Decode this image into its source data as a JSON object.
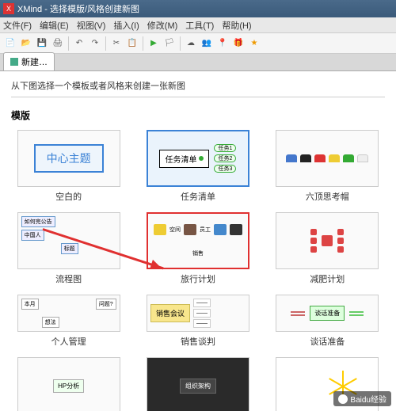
{
  "window": {
    "title": "XMind - 选择模版/风格创建新图",
    "app_icon_label": "X"
  },
  "menu": {
    "file": "文件(F)",
    "edit": "编辑(E)",
    "view": "视图(V)",
    "insert": "插入(I)",
    "modify": "修改(M)",
    "tools": "工具(T)",
    "help": "帮助(H)"
  },
  "tab": {
    "label": "新建…"
  },
  "intro": "从下图选择一个模板或者风格来创建一张新图",
  "section": {
    "templates": "模版"
  },
  "templates": [
    {
      "label": "空白的",
      "title_inside": "中心主题"
    },
    {
      "label": "任务清单",
      "title_inside": "任务清单",
      "branch": "任务"
    },
    {
      "label": "六顶思考帽"
    },
    {
      "label": "流程图",
      "box1": "如何完公告",
      "box2": "中国人",
      "box3": "标题"
    },
    {
      "label": "旅行计划",
      "items": [
        "空间",
        "员工",
        "销售"
      ]
    },
    {
      "label": "减肥计划"
    },
    {
      "label": "个人管理",
      "nodes": [
        "本月",
        "问题?",
        "想法"
      ]
    },
    {
      "label": "销售谈判",
      "box": "销售会议"
    },
    {
      "label": "谈话准备",
      "box": "谈话准备"
    },
    {
      "label": "",
      "box": "HP分析"
    },
    {
      "label": "",
      "box": "组织架构"
    },
    {
      "label": ""
    }
  ],
  "colors": {
    "hats": [
      "#4477cc",
      "#222",
      "#d33",
      "#ec3",
      "#3a3",
      "#eee"
    ]
  },
  "watermark": "Baidu经验"
}
